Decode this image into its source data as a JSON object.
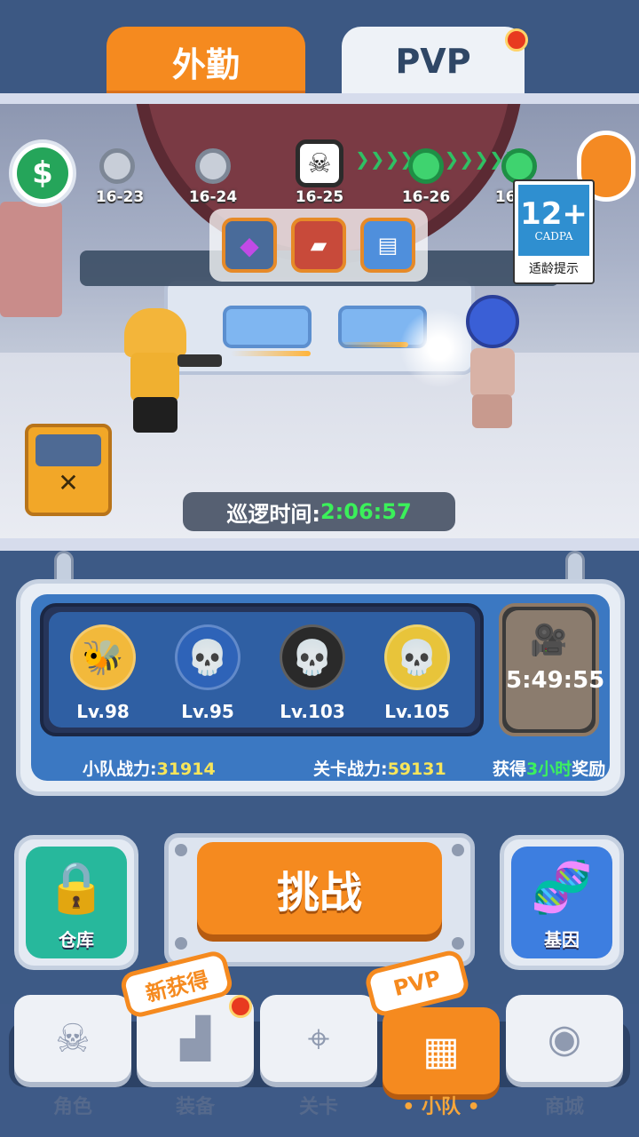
{
  "top_tabs": {
    "outwork": "外勤",
    "pvp": "PVP"
  },
  "stages": [
    {
      "label": "16-23",
      "state": "cleared"
    },
    {
      "label": "16-24",
      "state": "cleared"
    },
    {
      "label": "16-25",
      "state": "boss"
    },
    {
      "label": "16-26",
      "state": "upcoming"
    },
    {
      "label": "16-27",
      "state": "upcoming"
    }
  ],
  "rewards": [
    {
      "icon": "gem-icon"
    },
    {
      "icon": "gun-blueprint-icon"
    },
    {
      "icon": "chip-icon"
    }
  ],
  "age_rating": {
    "age": "12+",
    "org": "CADPA",
    "tip": "适龄提示"
  },
  "patrol": {
    "label": "巡逻时间:",
    "time": "2:06:57"
  },
  "squad": {
    "members": [
      {
        "level": "Lv.98",
        "color": "#f2b93b"
      },
      {
        "level": "Lv.95",
        "color": "#2e63b8"
      },
      {
        "level": "Lv.103",
        "color": "#2a2a2a"
      },
      {
        "level": "Lv.105",
        "color": "#e8c43a"
      }
    ],
    "video_countdown": "5:49:55",
    "squad_power_label": "小队战力:",
    "squad_power_value": "31914",
    "stage_power_label": "关卡战力:",
    "stage_power_value": "59131",
    "reward_prefix": "获得",
    "reward_hours": "3小时",
    "reward_suffix": "奖励"
  },
  "actions": {
    "warehouse": "仓库",
    "challenge": "挑战",
    "gene": "基因"
  },
  "nav": {
    "items": [
      "角色",
      "装备",
      "关卡",
      "小队",
      "商城"
    ],
    "active_index": 3,
    "new_badge": "新获得",
    "pvp_badge": "PVP"
  },
  "colors": {
    "accent_orange": "#f58a1f",
    "patrol_green": "#3bf05a",
    "power_yellow": "#f7e55a"
  }
}
